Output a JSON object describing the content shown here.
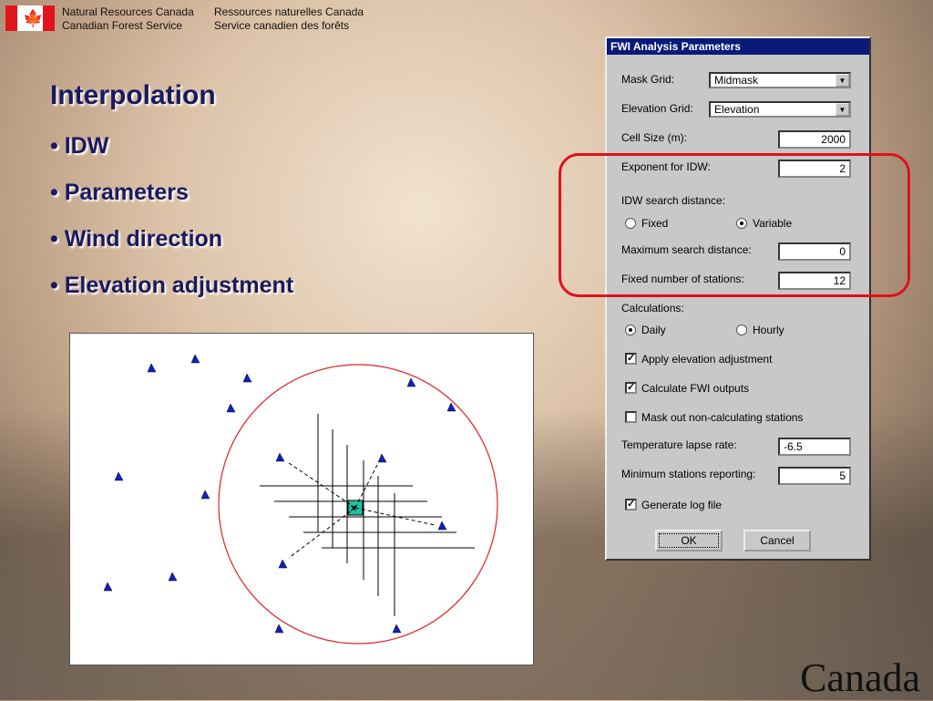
{
  "header": {
    "en_line1": "Natural Resources Canada",
    "en_line2": "Canadian Forest Service",
    "fr_line1": "Ressources naturelles Canada",
    "fr_line2": "Service canadien des forêts"
  },
  "slide": {
    "title": "Interpolation",
    "bullets": [
      "• IDW",
      "• Parameters",
      "• Wind direction",
      "• Elevation adjustment"
    ]
  },
  "dialog": {
    "title": "FWI Analysis Parameters",
    "mask_grid_label": "Mask Grid:",
    "mask_grid_value": "Midmask",
    "elevation_grid_label": "Elevation Grid:",
    "elevation_grid_value": "Elevation",
    "cell_size_label": "Cell Size (m):",
    "cell_size_value": "2000",
    "exponent_label": "Exponent for IDW:",
    "exponent_value": "2",
    "search_distance_label": "IDW search distance:",
    "fixed_label": "Fixed",
    "variable_label": "Variable",
    "search_mode": "Variable",
    "max_search_label": "Maximum search distance:",
    "max_search_value": "0",
    "fixed_stations_label": "Fixed number of stations:",
    "fixed_stations_value": "12",
    "calculations_label": "Calculations:",
    "daily_label": "Daily",
    "hourly_label": "Hourly",
    "calc_mode": "Daily",
    "apply_elev_label": "Apply elevation adjustment",
    "apply_elev_checked": true,
    "calc_fwi_label": "Calculate FWI outputs",
    "calc_fwi_checked": true,
    "mask_out_label": "Mask out non-calculating stations",
    "mask_out_checked": false,
    "lapse_label": "Temperature lapse rate:",
    "lapse_value": "-6.5",
    "min_stations_label": "Minimum stations reporting:",
    "min_stations_value": "5",
    "log_label": "Generate log file",
    "log_checked": true,
    "ok_label": "OK",
    "cancel_label": "Cancel"
  },
  "logo": {
    "wordmark": "Canada"
  }
}
